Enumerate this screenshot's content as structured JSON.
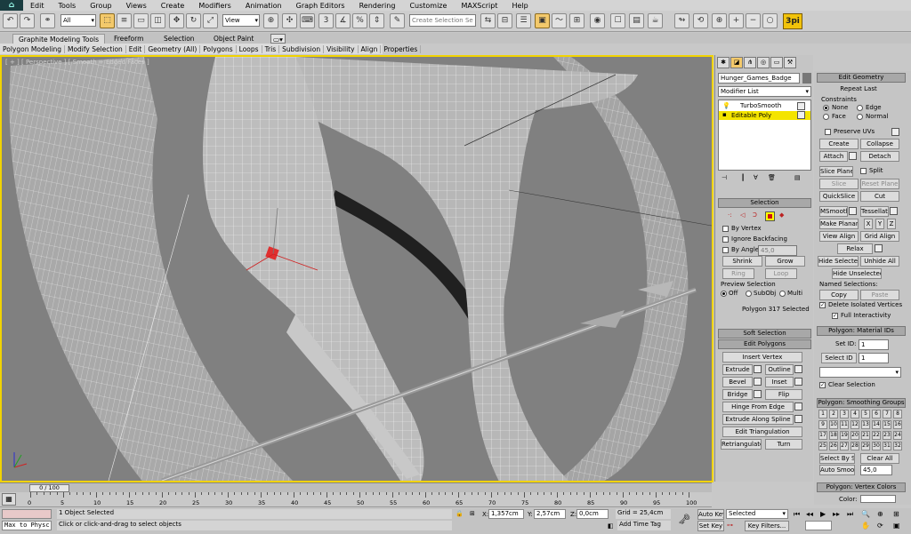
{
  "menu": [
    "Edit",
    "Tools",
    "Group",
    "Views",
    "Create",
    "Modifiers",
    "Animation",
    "Graph Editors",
    "Rendering",
    "Customize",
    "MAXScript",
    "Help"
  ],
  "toolbar": {
    "filter_value": "All",
    "view_value": "View",
    "named_selection_placeholder": "Create Selection Se",
    "brand_badge": "3pi"
  },
  "ribbon": {
    "tabs": [
      "Graphite Modeling Tools",
      "Freeform",
      "Selection",
      "Object Paint"
    ],
    "subtabs": [
      "Polygon Modeling",
      "Modify Selection",
      "Edit",
      "Geometry (All)",
      "Polygons",
      "Loops",
      "Tris",
      "Subdivision",
      "Visibility",
      "Align",
      "Properties"
    ]
  },
  "viewport": {
    "label": "[ + ] [ Perspective ] [ Smooth + Edged Faces ]"
  },
  "modify_panel": {
    "object_name": "Hunger_Games_Badge",
    "modifier_list_label": "Modifier List",
    "stack": [
      {
        "label": "TurboSmooth",
        "selected": false
      },
      {
        "label": "Editable Poly",
        "selected": true
      }
    ],
    "selection": {
      "title": "Selection",
      "by_vertex": "By Vertex",
      "ignore_backfacing": "Ignore Backfacing",
      "by_angle": "By Angle:",
      "by_angle_value": "45,0",
      "shrink": "Shrink",
      "grow": "Grow",
      "ring": "Ring",
      "loop": "Loop",
      "preview_selection": "Preview Selection",
      "off": "Off",
      "subobj": "SubObj",
      "multi": "Multi",
      "status": "Polygon 317 Selected"
    },
    "soft_selection": "Soft Selection",
    "edit_polygons": {
      "title": "Edit Polygons",
      "insert_vertex": "Insert Vertex",
      "extrude": "Extrude",
      "outline": "Outline",
      "bevel": "Bevel",
      "inset": "Inset",
      "bridge": "Bridge",
      "flip": "Flip",
      "hinge": "Hinge From Edge",
      "extrude_spline": "Extrude Along Spline",
      "edit_tri": "Edit Triangulation",
      "retriangulate": "Retriangulate",
      "turn": "Turn"
    }
  },
  "geometry_panel": {
    "title": "Edit Geometry",
    "repeat_last": "Repeat Last",
    "constraints": "Constraints",
    "none": "None",
    "edge": "Edge",
    "face": "Face",
    "normal": "Normal",
    "preserve_uvs": "Preserve UVs",
    "create": "Create",
    "collapse": "Collapse",
    "attach": "Attach",
    "detach": "Detach",
    "slice_plane": "Slice Plane",
    "split": "Split",
    "slice": "Slice",
    "reset_plane": "Reset Plane",
    "quickslice": "QuickSlice",
    "cut": "Cut",
    "msmooth": "MSmooth",
    "tessellate": "Tessellate",
    "make_planar": "Make Planar",
    "x": "X",
    "y": "Y",
    "z": "Z",
    "view_align": "View Align",
    "grid_align": "Grid Align",
    "relax": "Relax",
    "hide_selected": "Hide Selected",
    "unhide_all": "Unhide All",
    "hide_unselected": "Hide Unselected",
    "named_selections": "Named Selections:",
    "copy": "Copy",
    "paste": "Paste",
    "delete_isolated": "Delete Isolated Vertices",
    "full_interactivity": "Full Interactivity",
    "mat_title": "Polygon: Material IDs",
    "set_id": "Set ID:",
    "set_id_value": "1",
    "select_id": "Select ID",
    "select_id_value": "1",
    "clear_selection": "Clear Selection",
    "sg_title": "Polygon: Smoothing Groups",
    "sg_numbers": [
      "1",
      "2",
      "3",
      "4",
      "5",
      "6",
      "7",
      "8",
      "9",
      "10",
      "11",
      "12",
      "13",
      "14",
      "15",
      "16",
      "17",
      "18",
      "19",
      "20",
      "21",
      "22",
      "23",
      "24",
      "25",
      "26",
      "27",
      "28",
      "29",
      "30",
      "31",
      "32"
    ],
    "select_by_sg": "Select By SG",
    "clear_all": "Clear All",
    "auto_smooth": "Auto Smooth",
    "auto_smooth_value": "45,0",
    "vc_title": "Polygon: Vertex Colors",
    "color_label": "Color:"
  },
  "timeline": {
    "frame": "0 / 100",
    "ticks": [
      "0",
      "5",
      "10",
      "15",
      "20",
      "25",
      "30",
      "35",
      "40",
      "45",
      "50",
      "55",
      "60",
      "65",
      "70",
      "75",
      "80",
      "85",
      "90",
      "95",
      "100"
    ]
  },
  "status": {
    "script_label": "Max to Physc",
    "objects_selected": "1 Object Selected",
    "hint": "Click or click-and-drag to select objects",
    "x_label": "X:",
    "x_value": "1,357cm",
    "y_label": "Y:",
    "y_value": "2,57cm",
    "z_label": "Z:",
    "z_value": "0,0cm",
    "grid": "Grid = 25,4cm",
    "add_time_tag": "Add Time Tag",
    "auto_key": "Auto Key",
    "set_key": "Set Key",
    "selected_value": "Selected",
    "key_filters": "Key Filters..."
  }
}
